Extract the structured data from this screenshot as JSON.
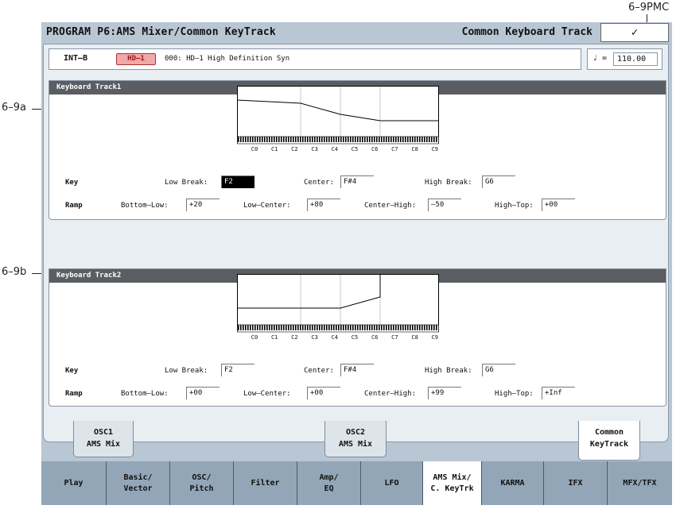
{
  "callouts": {
    "top": "6–9PMC",
    "a": "6–9a",
    "b": "6–9b"
  },
  "header": {
    "title": "PROGRAM P6:AMS Mixer/Common KeyTrack",
    "page_name": "Common Keyboard Track",
    "menu_icon": "chevron-down-icon",
    "menu_glyph": "✓"
  },
  "program": {
    "bank": "INT–B",
    "badge": "HD–1",
    "name": "000: HD–1 High Definition Syn"
  },
  "tempo": {
    "note_glyph": "♩ =",
    "value": "110.00"
  },
  "keyboard_tracks": [
    {
      "title": "Keyboard Track1",
      "key_label": "Key",
      "ramp_label": "Ramp",
      "low_break_label": "Low Break:",
      "low_break": "F2",
      "center_label": "Center:",
      "center": "F#4",
      "high_break_label": "High Break:",
      "high_break": "G6",
      "bottom_low_label": "Bottom–Low:",
      "bottom_low": "+20",
      "low_center_label": "Low–Center:",
      "low_center": "+80",
      "center_high_label": "Center–High:",
      "center_high": "–50",
      "high_top_label": "High–Top:",
      "high_top": "+00"
    },
    {
      "title": "Keyboard Track2",
      "key_label": "Key",
      "ramp_label": "Ramp",
      "low_break_label": "Low Break:",
      "low_break": "F2",
      "center_label": "Center:",
      "center": "F#4",
      "high_break_label": "High Break:",
      "high_break": "G6",
      "bottom_low_label": "Bottom–Low:",
      "bottom_low": "+00",
      "low_center_label": "Low–Center:",
      "low_center": "+00",
      "center_high_label": "Center–High:",
      "center_high": "+99",
      "high_top_label": "High–Top:",
      "high_top": "+Inf"
    }
  ],
  "octave_labels": [
    "C0",
    "C1",
    "C2",
    "C3",
    "C4",
    "C5",
    "C6",
    "C7",
    "C8",
    "C9"
  ],
  "upper_tabs": [
    {
      "line1": "OSC1",
      "line2": "AMS Mix"
    },
    {
      "line1": "OSC2",
      "line2": "AMS Mix"
    },
    {
      "line1": "Common",
      "line2": "KeyTrack"
    }
  ],
  "lower_tabs": [
    {
      "line1": "Play",
      "line2": ""
    },
    {
      "line1": "Basic/",
      "line2": "Vector"
    },
    {
      "line1": "OSC/",
      "line2": "Pitch"
    },
    {
      "line1": "Filter",
      "line2": ""
    },
    {
      "line1": "Amp/",
      "line2": "EQ"
    },
    {
      "line1": "LFO",
      "line2": ""
    },
    {
      "line1": "AMS Mix/",
      "line2": "C. KeyTrk"
    },
    {
      "line1": "KARMA",
      "line2": ""
    },
    {
      "line1": "IFX",
      "line2": ""
    },
    {
      "line1": "MFX/TFX",
      "line2": ""
    }
  ],
  "colors": {
    "screen_bg": "#b9c6d3",
    "header_bar": "#5a5e63",
    "tab_bg": "#93a6b8",
    "badge": "#f0a8a8"
  }
}
